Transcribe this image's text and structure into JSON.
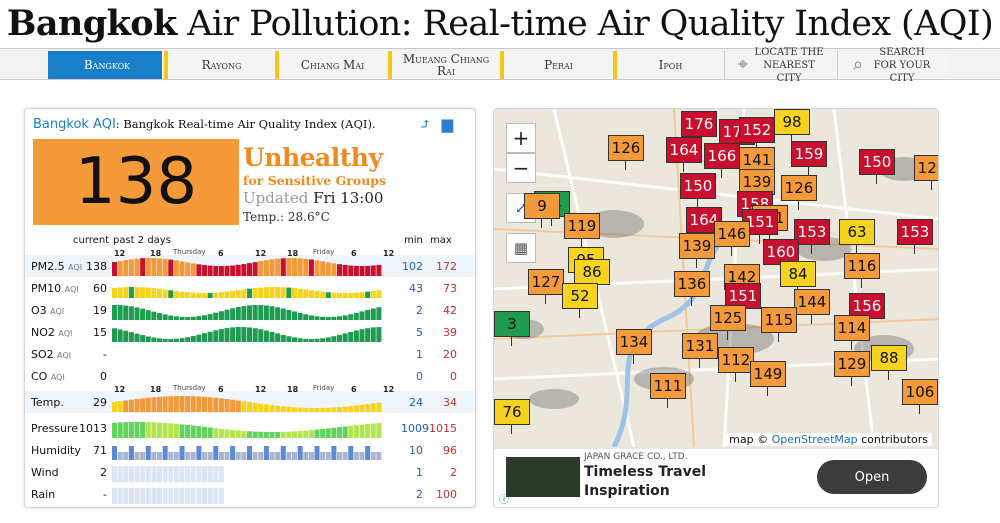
{
  "page_title": {
    "bold": "Bangkok",
    "rest": " Air Pollution: Real-time Air Quality Index (AQI)"
  },
  "tabs": [
    {
      "label": "Bangkok",
      "active": true
    },
    {
      "label": "Rayong"
    },
    {
      "label": "Chiang Mai"
    },
    {
      "label": "Mueang Chiang Rai"
    },
    {
      "label": "Perai"
    },
    {
      "label": "Ipoh"
    },
    {
      "label": "Locate the nearest city",
      "icon": "crosshair-icon"
    },
    {
      "label": "Search for your city",
      "icon": "search-icon"
    }
  ],
  "card": {
    "city_link": "Bangkok AQI",
    "subtitle": ": Bangkok Real-time Air Quality Index (AQI).",
    "aqi": "138",
    "status_main": "Unhealthy",
    "status_sub": "for Sensitive Groups",
    "updated_label": "Updated",
    "updated_time": "Fri 13:00",
    "temp": "Temp.: 28.6°C",
    "col_current": "current",
    "col_past": "past 2 days",
    "col_min": "min",
    "col_max": "max",
    "day_labels": [
      "Thursday",
      "Friday"
    ],
    "hour_ticks": [
      "12",
      "18",
      "6",
      "12",
      "18",
      "6",
      "12"
    ],
    "rows": [
      {
        "label": "PM2.5",
        "unit": "AQI",
        "current": "138",
        "min": "102",
        "max": "172",
        "type": "aqi"
      },
      {
        "label": "PM10",
        "unit": "AQI",
        "current": "60",
        "min": "43",
        "max": "73",
        "type": "aqi"
      },
      {
        "label": "O3",
        "unit": "AQI",
        "current": "19",
        "min": "2",
        "max": "42",
        "type": "aqi"
      },
      {
        "label": "NO2",
        "unit": "AQI",
        "current": "15",
        "min": "5",
        "max": "39",
        "type": "aqi"
      },
      {
        "label": "SO2",
        "unit": "AQI",
        "current": "-",
        "min": "1",
        "max": "20",
        "type": "none"
      },
      {
        "label": "CO",
        "unit": "AQI",
        "current": "0",
        "min": "0",
        "max": "0",
        "type": "none"
      },
      {
        "label": "Temp.",
        "unit": "",
        "current": "29",
        "min": "24",
        "max": "34",
        "type": "temp"
      },
      {
        "label": "Pressure",
        "unit": "",
        "current": "1013",
        "min": "1009",
        "max": "1015",
        "type": "pressure"
      },
      {
        "label": "Humidity",
        "unit": "",
        "current": "71",
        "min": "10",
        "max": "96",
        "type": "humidity"
      },
      {
        "label": "Wind",
        "unit": "",
        "current": "2",
        "min": "1",
        "max": "2",
        "type": "wind"
      },
      {
        "label": "Rain",
        "unit": "",
        "current": "-",
        "min": "2",
        "max": "100",
        "type": "wind"
      }
    ]
  },
  "colors": {
    "good": "#1f9b52",
    "moderate": "#f5d31f",
    "usg": "#f49a3b",
    "unhealthy": "#c8102e",
    "accent": "#1a7fc9"
  },
  "map": {
    "attribution_prefix": "map © ",
    "attribution_link": "OpenStreetMap",
    "attribution_suffix": " contributors",
    "zoom_in": "+",
    "zoom_out": "−",
    "markers": [
      {
        "v": "176",
        "c": "red"
      },
      {
        "v": "174",
        "c": "red"
      },
      {
        "v": "152",
        "c": "red"
      },
      {
        "v": "98",
        "c": "yellow"
      },
      {
        "v": "126",
        "c": "orange"
      },
      {
        "v": "164",
        "c": "red"
      },
      {
        "v": "166",
        "c": "red"
      },
      {
        "v": "141",
        "c": "orange"
      },
      {
        "v": "159",
        "c": "red"
      },
      {
        "v": "150",
        "c": "red"
      },
      {
        "v": "126",
        "c": "orange"
      },
      {
        "v": "150",
        "c": "red"
      },
      {
        "v": "139",
        "c": "orange"
      },
      {
        "v": "126",
        "c": "orange"
      },
      {
        "v": "14",
        "c": "green"
      },
      {
        "v": "158",
        "c": "red"
      },
      {
        "v": "141",
        "c": "orange"
      },
      {
        "v": "119",
        "c": "orange"
      },
      {
        "v": "164",
        "c": "red"
      },
      {
        "v": "151",
        "c": "red"
      },
      {
        "v": "153",
        "c": "red"
      },
      {
        "v": "63",
        "c": "yellow"
      },
      {
        "v": "153",
        "c": "red"
      },
      {
        "v": "146",
        "c": "orange"
      },
      {
        "v": "139",
        "c": "orange"
      },
      {
        "v": "160",
        "c": "red"
      },
      {
        "v": "116",
        "c": "orange"
      },
      {
        "v": "95",
        "c": "yellow"
      },
      {
        "v": "86",
        "c": "yellow"
      },
      {
        "v": "127",
        "c": "orange"
      },
      {
        "v": "136",
        "c": "orange"
      },
      {
        "v": "142",
        "c": "orange"
      },
      {
        "v": "84",
        "c": "yellow"
      },
      {
        "v": "52",
        "c": "yellow"
      },
      {
        "v": "151",
        "c": "red"
      },
      {
        "v": "144",
        "c": "orange"
      },
      {
        "v": "156",
        "c": "red"
      },
      {
        "v": "114",
        "c": "orange"
      },
      {
        "v": "125",
        "c": "orange"
      },
      {
        "v": "115",
        "c": "orange"
      },
      {
        "v": "134",
        "c": "orange"
      },
      {
        "v": "131",
        "c": "orange"
      },
      {
        "v": "112",
        "c": "orange"
      },
      {
        "v": "129",
        "c": "orange"
      },
      {
        "v": "88",
        "c": "yellow"
      },
      {
        "v": "149",
        "c": "orange"
      },
      {
        "v": "111",
        "c": "orange"
      },
      {
        "v": "106",
        "c": "orange"
      },
      {
        "v": "76",
        "c": "yellow"
      },
      {
        "v": "3",
        "c": "green"
      },
      {
        "v": "9",
        "c": "orange"
      }
    ]
  },
  "ad": {
    "company": "JAPAN GRACE CO., LTD.",
    "title": "Timeless Travel Inspiration",
    "button": "Open"
  }
}
